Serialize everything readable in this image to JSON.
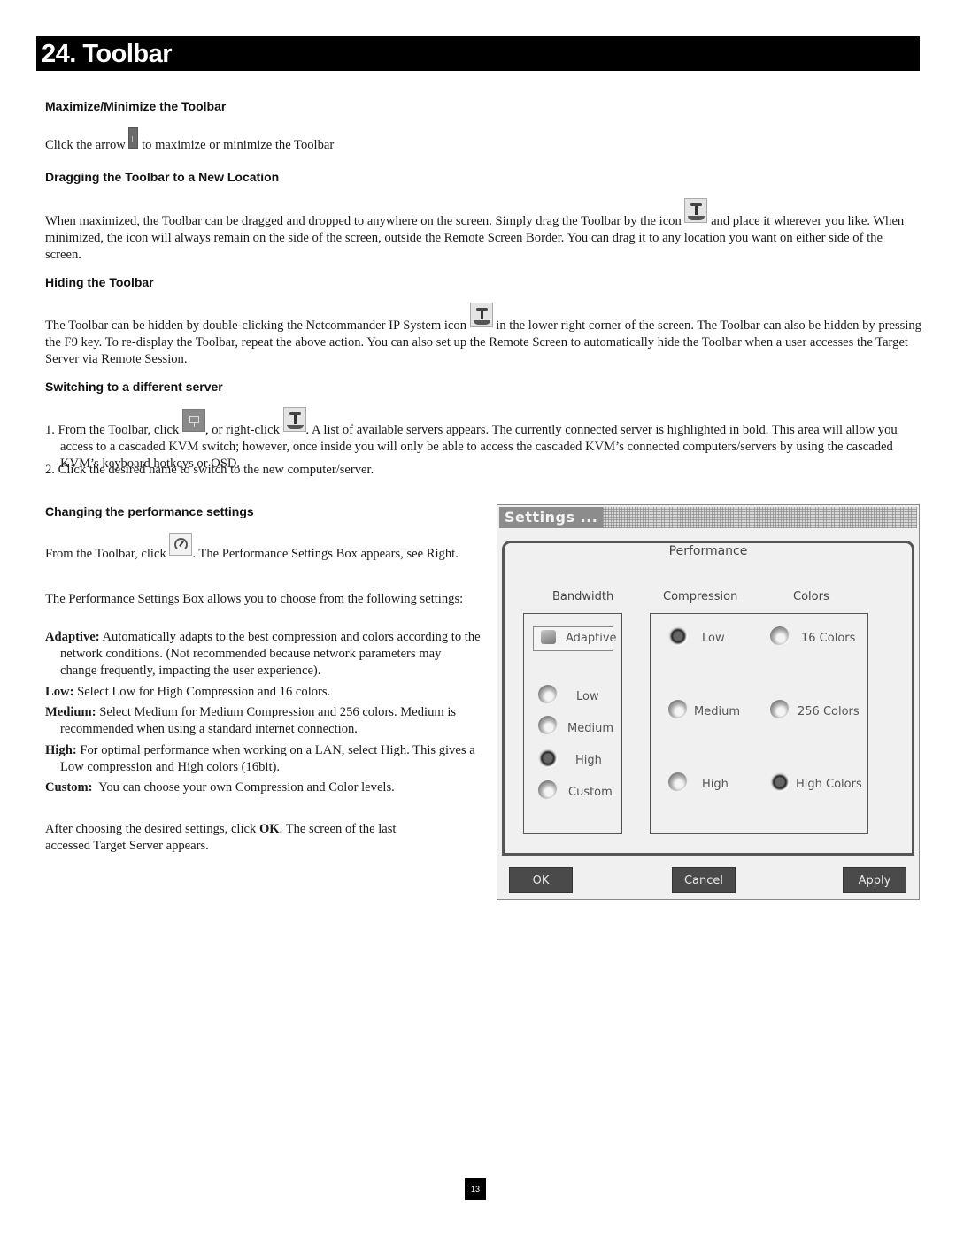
{
  "page": {
    "title": "24. Toolbar",
    "page_number": "13"
  },
  "sections": {
    "maximize": {
      "heading": "Maximize/Minimize the Toolbar",
      "text_before": "Click the arrow ",
      "icon": "toolbar-arrow-icon",
      "text_after": " to maximize or minimize the Toolbar"
    },
    "dragging": {
      "heading": "Dragging the Toolbar to a New Location",
      "text_before": "When maximized, the Toolbar can be dragged and dropped to anywhere on the screen. Simply drag the Toolbar by the icon ",
      "icon": "drag-handle-icon",
      "text_after": " and place it wherever you like. When minimized, the icon will always remain on the side of the screen, outside the Remote Screen Border. You can drag it to any location you want on either side of the screen."
    },
    "hiding": {
      "heading": "Hiding the Toolbar",
      "text_before": "The Toolbar can be hidden by double-clicking the Netcommander IP System icon ",
      "icon": "netcommander-system-icon",
      "text_after": " in the lower right corner of the screen. The Toolbar can also be hidden by pressing the F9 key. To re-display the Toolbar, repeat the above action. You can also set up the Remote Screen to automatically hide the Toolbar when a user accesses the Target Server via Remote Session."
    },
    "switching": {
      "heading": "Switching to a different server",
      "step1_a": "1. From the Toolbar, click ",
      "step1_icon1": "server-list-icon",
      "step1_b": ", or right-click ",
      "step1_icon2": "netcommander-system-icon",
      "step1_c": ". A list of available servers appears. The currently connected server is highlighted in bold. This area will allow you access to a cascaded KVM switch; however, once inside you will only be able to access the cascaded KVM’s connected computers/servers by using the cascaded KVM’s keyboard hotkeys or OSD.",
      "step2": "2. Click the desired name to switch to the new computer/server."
    },
    "performance": {
      "heading": "Changing the performance settings",
      "intro_before": "From the Toolbar, click ",
      "intro_icon": "performance-gauge-icon",
      "intro_after": ". The Performance Settings Box appears, see Right.",
      "allows": "The Performance Settings Box allows you to choose from the following settings:",
      "options": [
        {
          "term": "Adaptive:",
          "desc": " Automatically adapts to the best compression and colors according to the network conditions. (Not recommended because network parameters may change frequently, impacting the user experience)."
        },
        {
          "term": "Low:",
          "desc": " Select Low for High Compression and 16 colors."
        },
        {
          "term": "Medium:",
          "desc": " Select Medium for Medium Compression and 256 colors. Medium is recommended when using a standard internet connection."
        },
        {
          "term": "High:",
          "desc": " For optimal performance when working on a LAN, select High. This gives a Low compression and High colors (16bit)."
        },
        {
          "term": "Custom:",
          "desc": "  You can choose your own Compression and Color levels."
        }
      ],
      "after_before": "After choosing the desired settings, click ",
      "after_bold": "OK",
      "after_after": ". The screen of the last accessed Target Server appears."
    }
  },
  "dialog": {
    "title": "Settings ...",
    "group_label": "Performance",
    "columns": {
      "bandwidth": "Bandwidth",
      "compression": "Compression",
      "colors": "Colors"
    },
    "bandwidth": {
      "adaptive": "Adaptive",
      "options": [
        {
          "label": "Low",
          "selected": false
        },
        {
          "label": "Medium",
          "selected": false
        },
        {
          "label": "High",
          "selected": true
        },
        {
          "label": "Custom",
          "selected": false
        }
      ]
    },
    "compression": [
      {
        "label": "Low",
        "selected": true
      },
      {
        "label": "Medium",
        "selected": false
      },
      {
        "label": "High",
        "selected": false
      }
    ],
    "colors": [
      {
        "label": "16 Colors",
        "selected": false
      },
      {
        "label": "256 Colors",
        "selected": false
      },
      {
        "label": "High Colors",
        "selected": true
      }
    ],
    "buttons": {
      "ok": "OK",
      "cancel": "Cancel",
      "apply": "Apply"
    }
  }
}
